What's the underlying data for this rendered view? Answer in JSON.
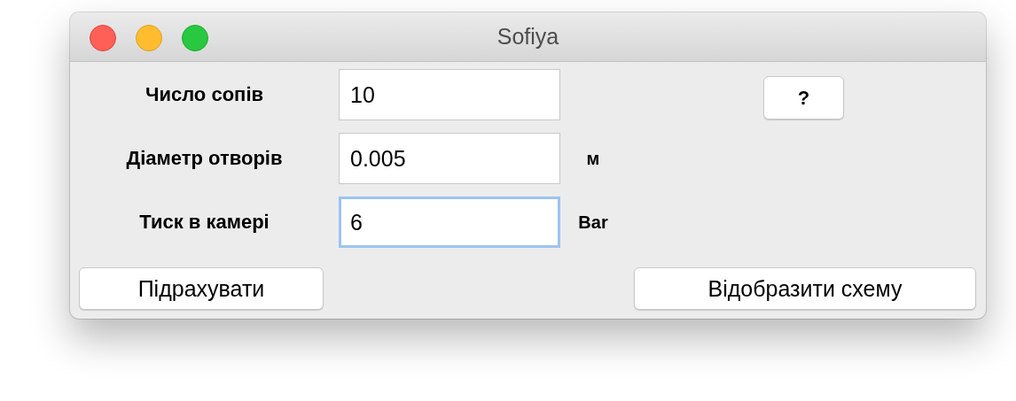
{
  "window": {
    "title": "Sofiya"
  },
  "fields": [
    {
      "label": "Число сопів",
      "value": "10",
      "focused": false
    },
    {
      "label": "Діаметр отворів",
      "value": "0.005",
      "unit": "м",
      "focused": false
    },
    {
      "label": "Тиск в камері",
      "value": "6",
      "unit": "Bar",
      "focused": true
    }
  ],
  "help_button": "?",
  "buttons": [
    {
      "label": "Підрахувати"
    },
    {
      "label": "Відобразити схему"
    }
  ]
}
